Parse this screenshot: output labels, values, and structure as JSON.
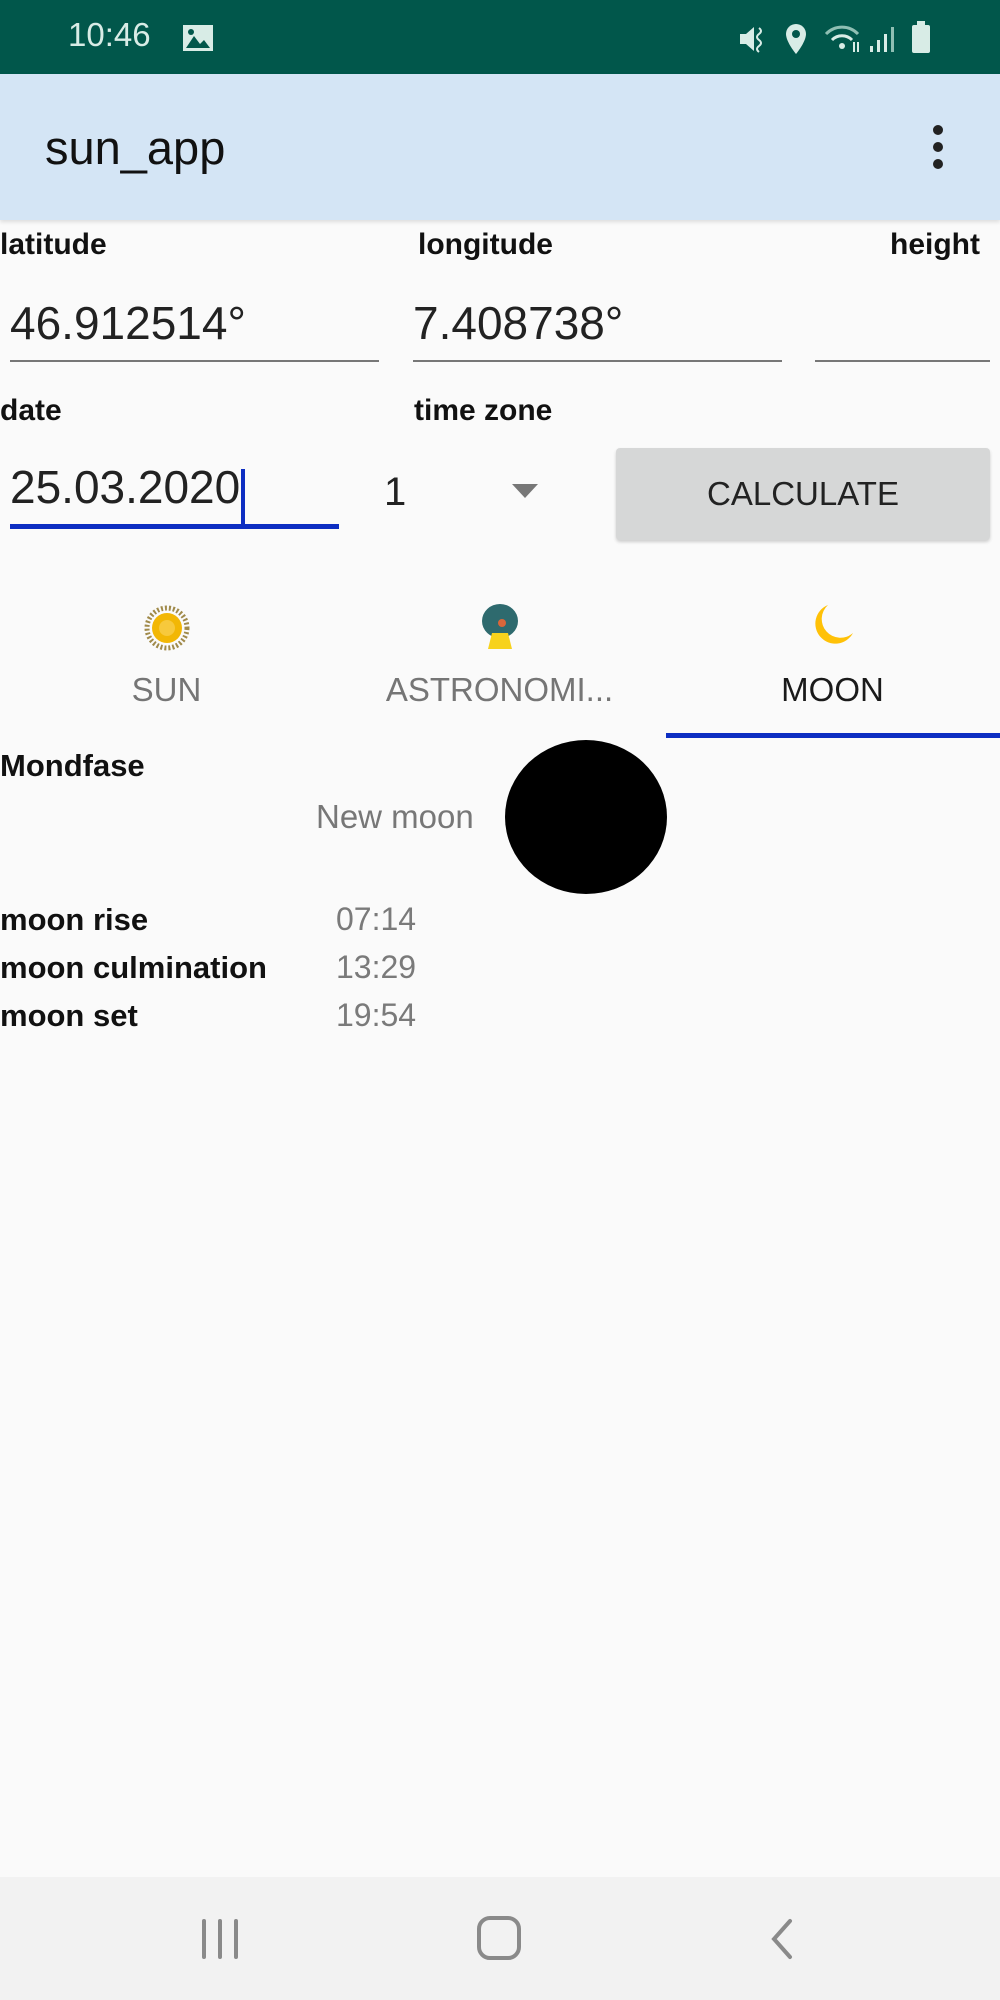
{
  "status_bar": {
    "time": "10:46",
    "icons": [
      "gallery-icon",
      "mute-vibrate-icon",
      "location-icon",
      "wifi-icon",
      "signal-icon",
      "battery-icon"
    ]
  },
  "app_bar": {
    "title": "sun_app",
    "menu_icon": "more-vert-icon"
  },
  "form": {
    "latitude_label": "latitude",
    "latitude_value": "46.912514°",
    "longitude_label": "longitude",
    "longitude_value": "7.408738°",
    "height_label": "height",
    "height_value": "",
    "date_label": "date",
    "date_value": "25.03.2020",
    "timezone_label": "time zone",
    "timezone_value": "1",
    "calculate_label": "CALCULATE"
  },
  "tabs": [
    {
      "label": "SUN",
      "icon": "sun-icon",
      "selected": false
    },
    {
      "label": "ASTRONOMI...",
      "icon": "astronomical-icon",
      "selected": false
    },
    {
      "label": "MOON",
      "icon": "moon-icon",
      "selected": true
    }
  ],
  "moon": {
    "phase_label": "Mondfase",
    "phase_value": "New moon",
    "rows": [
      {
        "label": "moon rise",
        "value": "07:14"
      },
      {
        "label": "moon culmination",
        "value": "13:29"
      },
      {
        "label": "moon set",
        "value": "19:54"
      }
    ]
  },
  "colors": {
    "status_bar": "#01574b",
    "app_bar": "#d4e5f5",
    "accent": "#0d2ec2",
    "sun": "#f2b705",
    "moon": "#ffc107"
  }
}
